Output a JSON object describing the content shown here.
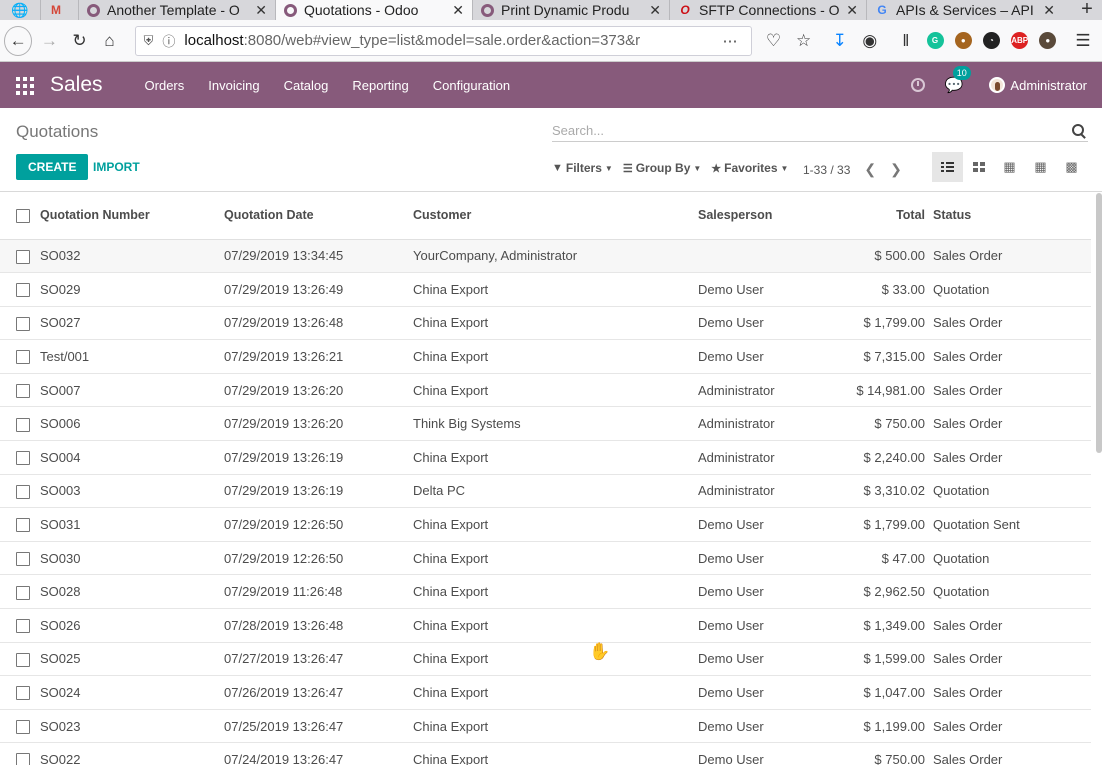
{
  "browser": {
    "tabs": [
      {
        "title": "",
        "icon": "gmail-icon"
      },
      {
        "title": "Another Template - O",
        "icon": "odoo-icon"
      },
      {
        "title": "Quotations - Odoo",
        "icon": "odoo-icon",
        "active": true
      },
      {
        "title": "Print Dynamic Produ",
        "icon": "odoo-icon"
      },
      {
        "title": "SFTP Connections - O",
        "icon": "opera-icon"
      },
      {
        "title": "APIs & Services – API",
        "icon": "google-icon"
      }
    ],
    "url_host": "localhost",
    "url_rest": ":8080/web#view_type=list&model=sale.order&action=373&r"
  },
  "app": {
    "name": "Sales",
    "menu": [
      "Orders",
      "Invoicing",
      "Catalog",
      "Reporting",
      "Configuration"
    ],
    "chat_badge": "10",
    "user": "Administrator"
  },
  "control_panel": {
    "title": "Quotations",
    "search_placeholder": "Search...",
    "create_label": "CREATE",
    "import_label": "IMPORT",
    "filters_label": "Filters",
    "groupby_label": "Group By",
    "favorites_label": "Favorites",
    "pager": "1-33 / 33"
  },
  "table": {
    "headers": {
      "number": "Quotation Number",
      "date": "Quotation Date",
      "customer": "Customer",
      "salesperson": "Salesperson",
      "total": "Total",
      "status": "Status"
    },
    "rows": [
      {
        "number": "SO032",
        "date": "07/29/2019 13:34:45",
        "customer": "YourCompany, Administrator",
        "salesperson": "",
        "total": "$ 500.00",
        "status": "Sales Order"
      },
      {
        "number": "SO029",
        "date": "07/29/2019 13:26:49",
        "customer": "China Export",
        "salesperson": "Demo User",
        "total": "$ 33.00",
        "status": "Quotation"
      },
      {
        "number": "SO027",
        "date": "07/29/2019 13:26:48",
        "customer": "China Export",
        "salesperson": "Demo User",
        "total": "$ 1,799.00",
        "status": "Sales Order"
      },
      {
        "number": "Test/001",
        "date": "07/29/2019 13:26:21",
        "customer": "China Export",
        "salesperson": "Demo User",
        "total": "$ 7,315.00",
        "status": "Sales Order"
      },
      {
        "number": "SO007",
        "date": "07/29/2019 13:26:20",
        "customer": "China Export",
        "salesperson": "Administrator",
        "total": "$ 14,981.00",
        "status": "Sales Order"
      },
      {
        "number": "SO006",
        "date": "07/29/2019 13:26:20",
        "customer": "Think Big Systems",
        "salesperson": "Administrator",
        "total": "$ 750.00",
        "status": "Sales Order"
      },
      {
        "number": "SO004",
        "date": "07/29/2019 13:26:19",
        "customer": "China Export",
        "salesperson": "Administrator",
        "total": "$ 2,240.00",
        "status": "Sales Order"
      },
      {
        "number": "SO003",
        "date": "07/29/2019 13:26:19",
        "customer": "Delta PC",
        "salesperson": "Administrator",
        "total": "$ 3,310.02",
        "status": "Quotation"
      },
      {
        "number": "SO031",
        "date": "07/29/2019 12:26:50",
        "customer": "China Export",
        "salesperson": "Demo User",
        "total": "$ 1,799.00",
        "status": "Quotation Sent"
      },
      {
        "number": "SO030",
        "date": "07/29/2019 12:26:50",
        "customer": "China Export",
        "salesperson": "Demo User",
        "total": "$ 47.00",
        "status": "Quotation"
      },
      {
        "number": "SO028",
        "date": "07/29/2019 11:26:48",
        "customer": "China Export",
        "salesperson": "Demo User",
        "total": "$ 2,962.50",
        "status": "Quotation"
      },
      {
        "number": "SO026",
        "date": "07/28/2019 13:26:48",
        "customer": "China Export",
        "salesperson": "Demo User",
        "total": "$ 1,349.00",
        "status": "Sales Order"
      },
      {
        "number": "SO025",
        "date": "07/27/2019 13:26:47",
        "customer": "China Export",
        "salesperson": "Demo User",
        "total": "$ 1,599.00",
        "status": "Sales Order"
      },
      {
        "number": "SO024",
        "date": "07/26/2019 13:26:47",
        "customer": "China Export",
        "salesperson": "Demo User",
        "total": "$ 1,047.00",
        "status": "Sales Order"
      },
      {
        "number": "SO023",
        "date": "07/25/2019 13:26:47",
        "customer": "China Export",
        "salesperson": "Demo User",
        "total": "$ 1,199.00",
        "status": "Sales Order"
      },
      {
        "number": "SO022",
        "date": "07/24/2019 13:26:47",
        "customer": "China Export",
        "salesperson": "Demo User",
        "total": "$ 750.00",
        "status": "Sales Order"
      }
    ]
  },
  "colors": {
    "brand": "#875a7b",
    "accent": "#00a09d"
  }
}
